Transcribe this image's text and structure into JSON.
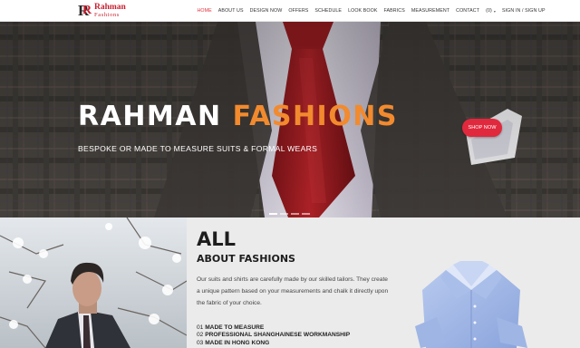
{
  "brand": {
    "logo_mark": "R",
    "name": "Rahman",
    "tagline": "Fashions"
  },
  "nav": {
    "items": [
      {
        "label": "HOME",
        "active": true
      },
      {
        "label": "ABOUT US",
        "active": false
      },
      {
        "label": "DESIGN NOW",
        "active": false
      },
      {
        "label": "OFFERS",
        "active": false
      },
      {
        "label": "SCHEDULE",
        "active": false
      },
      {
        "label": "LOOK BOOK",
        "active": false
      },
      {
        "label": "FABRICS",
        "active": false
      },
      {
        "label": "MEASUREMENT",
        "active": false
      },
      {
        "label": "CONTACT",
        "active": false
      }
    ],
    "cart_label": "(0)",
    "signin_label": "SIGN IN / SIGN UP"
  },
  "hero": {
    "title_word1": "RAHMAN",
    "title_word2": "FASHIONS",
    "subtitle": "BESPOKE OR MADE TO MEASURE SUITS & FORMAL WEARS",
    "cta_label": "SHOP NOW",
    "slides_total": 4,
    "active_slide": 1
  },
  "about": {
    "heading_big": "ALL",
    "heading_small": "ABOUT FASHIONS",
    "paragraph": "Our suits and shirts are carefully made by our skilled tailors. They create a unique pattern based on your measurements and chalk it directly upon the fabric of your choice.",
    "features": [
      {
        "num": "01",
        "text": "MADE TO MEASURE"
      },
      {
        "num": "02",
        "text": "PROFESSIONAL SHANGHAINESE WORKMANSHIP"
      },
      {
        "num": "03",
        "text": "MADE IN HONG KONG"
      }
    ]
  },
  "colors": {
    "accent_red": "#e0293d",
    "accent_orange": "#f28a2e",
    "active_nav": "#e2313f"
  }
}
